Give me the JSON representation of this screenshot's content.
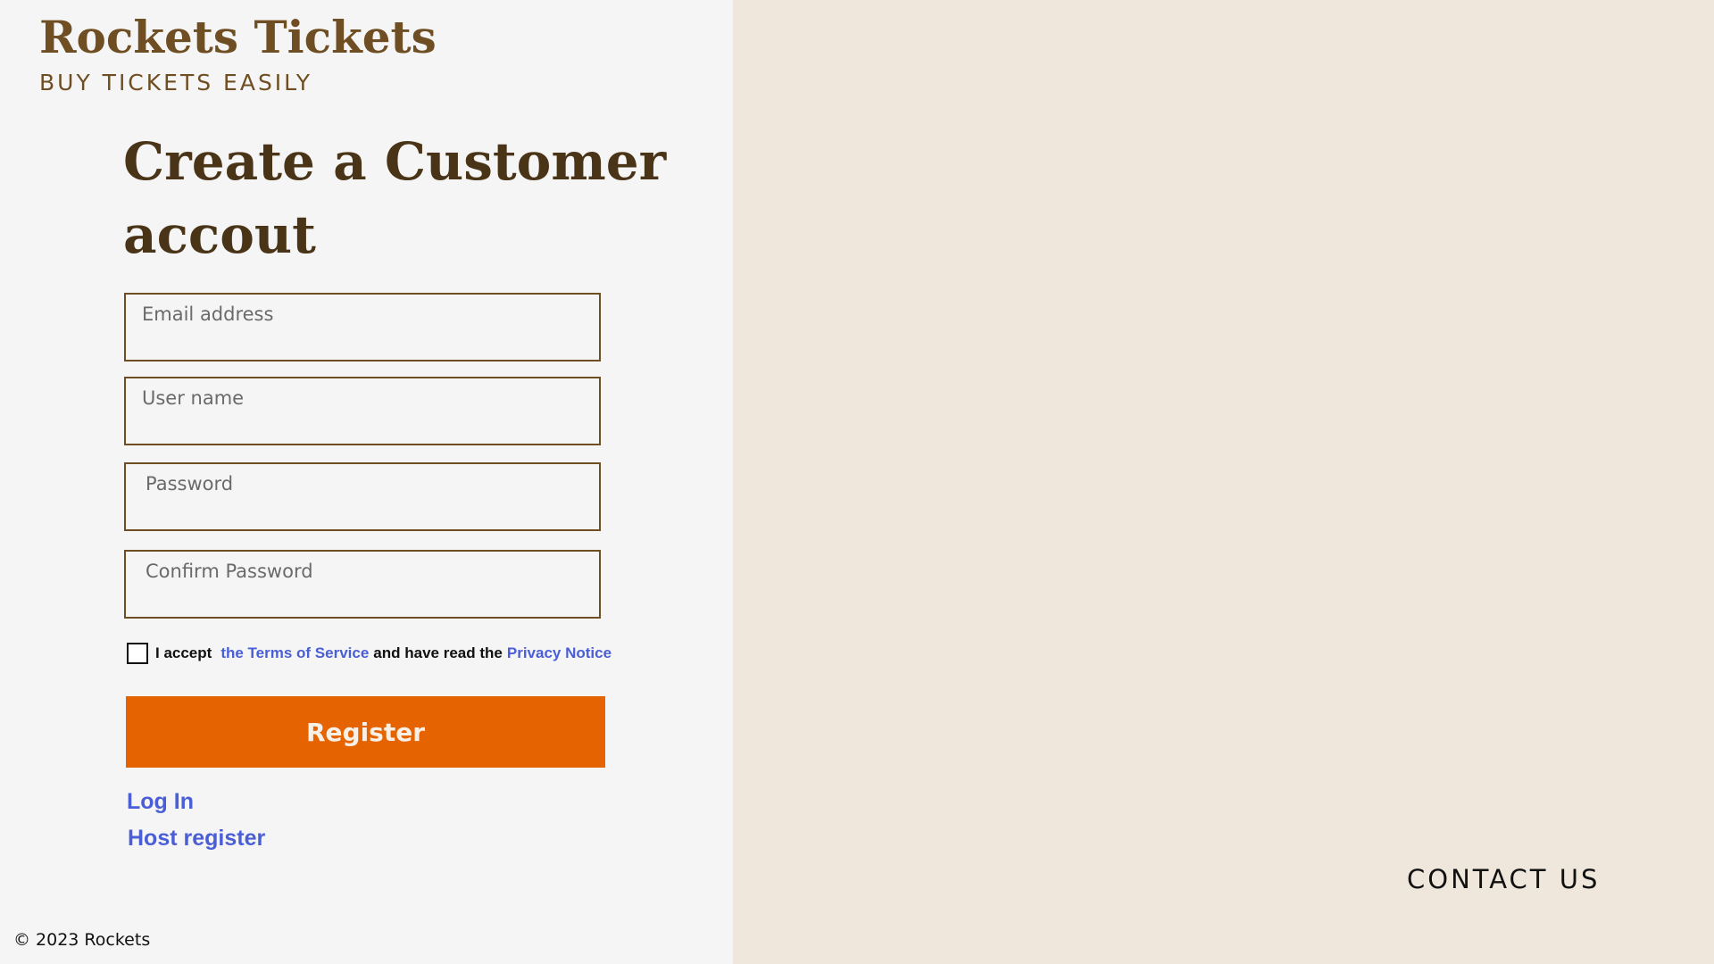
{
  "brand": {
    "title": "Rockets Tickets",
    "tagline": "BUY TICKETS EASILY",
    "color": "#6e4e22"
  },
  "form": {
    "heading": "Create a Customer accout",
    "email_placeholder": "Email address",
    "username_placeholder": "User name",
    "password_placeholder": "Password",
    "confirm_password_placeholder": "Confirm Password",
    "terms": {
      "prefix": "I accept",
      "terms_link": "the Terms of Service",
      "middle": "and have read the",
      "privacy_link": "Privacy Notice",
      "checked": false
    },
    "register_label": "Register"
  },
  "links": {
    "login": "Log In",
    "host_register": "Host register"
  },
  "footer": {
    "copyright": "© 2023 Rockets",
    "contact": "CONTACT US"
  },
  "colors": {
    "accent": "#e56300",
    "link": "#4a5ed6",
    "right_panel_bg": "#efe6dc",
    "left_panel_bg": "#f5f5f5"
  }
}
